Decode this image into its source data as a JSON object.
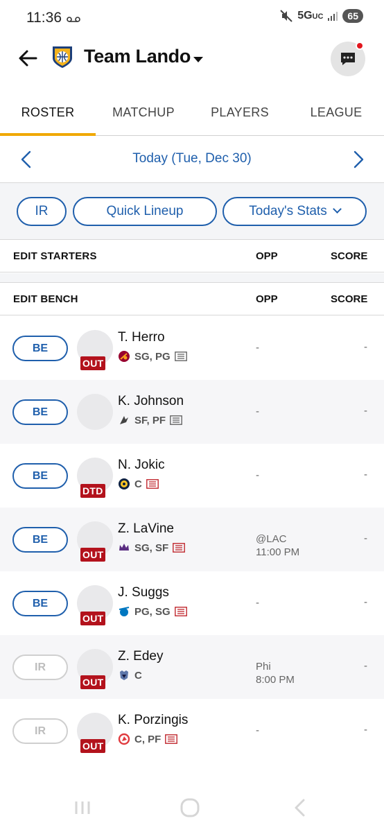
{
  "status_bar": {
    "time": "11:36",
    "network": "5G",
    "network_sub": "UC",
    "battery": "65"
  },
  "header": {
    "team_name": "Team Lando"
  },
  "tabs": [
    {
      "label": "ROSTER",
      "active": true
    },
    {
      "label": "MATCHUP",
      "active": false
    },
    {
      "label": "PLAYERS",
      "active": false
    },
    {
      "label": "LEAGUE",
      "active": false
    }
  ],
  "date_nav": {
    "label": "Today (Tue, Dec 30)"
  },
  "pills": {
    "ir": "IR",
    "quick_lineup": "Quick Lineup",
    "todays_stats": "Today's Stats"
  },
  "starters_header": {
    "label": "EDIT STARTERS",
    "opp": "OPP",
    "score": "SCORE"
  },
  "bench_header": {
    "label": "EDIT BENCH",
    "opp": "OPP",
    "score": "SCORE"
  },
  "players": [
    {
      "slot": "BE",
      "slot_enabled": true,
      "name": "T. Herro",
      "status": "OUT",
      "team": "Heat",
      "positions": "SG, PG",
      "news_alert": false,
      "opp_line1": "-",
      "opp_line2": "",
      "score": "-"
    },
    {
      "slot": "BE",
      "slot_enabled": true,
      "name": "K. Johnson",
      "status": "",
      "team": "Spurs",
      "positions": "SF, PF",
      "news_alert": false,
      "opp_line1": "-",
      "opp_line2": "",
      "score": "-"
    },
    {
      "slot": "BE",
      "slot_enabled": true,
      "name": "N. Jokic",
      "status": "DTD",
      "team": "Nuggets",
      "positions": "C",
      "news_alert": true,
      "opp_line1": "-",
      "opp_line2": "",
      "score": "-"
    },
    {
      "slot": "BE",
      "slot_enabled": true,
      "name": "Z. LaVine",
      "status": "OUT",
      "team": "Kings",
      "positions": "SG, SF",
      "news_alert": true,
      "opp_line1": "@LAC",
      "opp_line2": "11:00 PM",
      "score": "-"
    },
    {
      "slot": "BE",
      "slot_enabled": true,
      "name": "J. Suggs",
      "status": "OUT",
      "team": "Magic",
      "positions": "PG, SG",
      "news_alert": true,
      "opp_line1": "-",
      "opp_line2": "",
      "score": "-"
    },
    {
      "slot": "IR",
      "slot_enabled": false,
      "name": "Z. Edey",
      "status": "OUT",
      "team": "Grizzlies",
      "positions": "C",
      "news_alert": false,
      "opp_line1": "Phi",
      "opp_line2": "8:00 PM",
      "score": "-"
    },
    {
      "slot": "IR",
      "slot_enabled": false,
      "name": "K. Porzingis",
      "status": "OUT",
      "team": "Hawks",
      "positions": "C, PF",
      "news_alert": true,
      "opp_line1": "-",
      "opp_line2": "",
      "score": "-"
    }
  ],
  "colors": {
    "accent_blue": "#1f5fac",
    "tab_underline": "#f0a800",
    "status_red": "#b3121c",
    "news_red": "#c0272d"
  }
}
